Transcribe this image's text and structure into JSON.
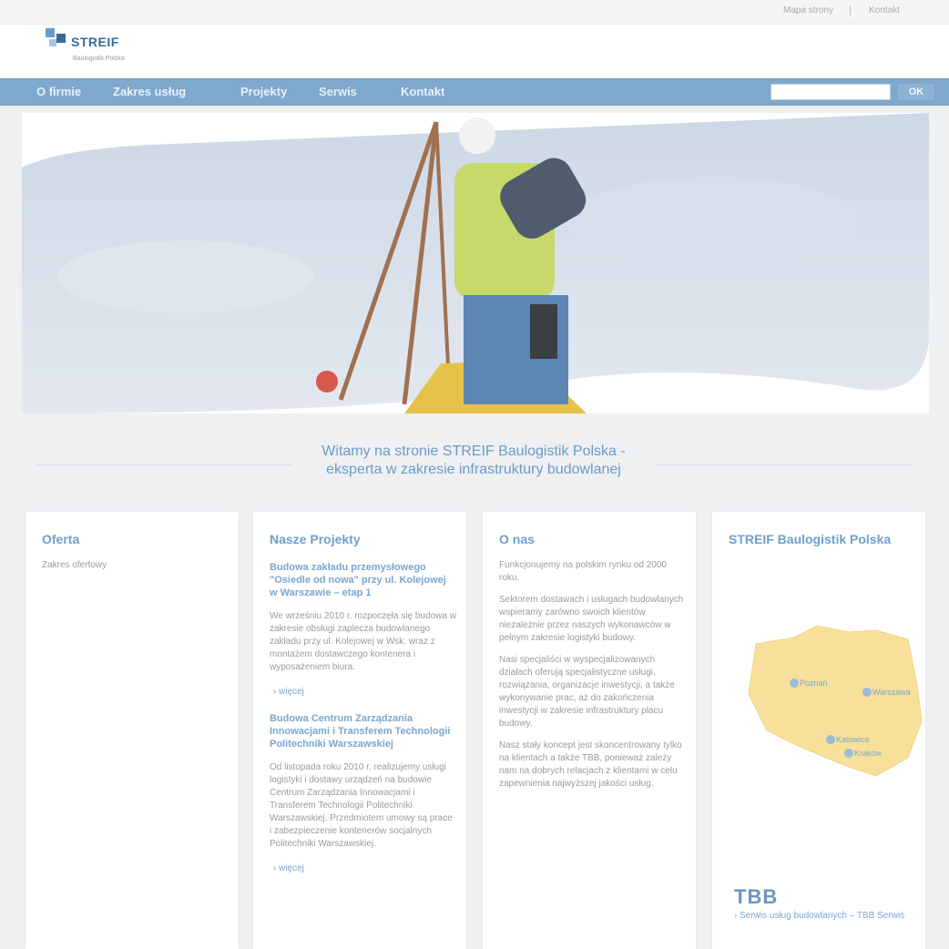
{
  "topbar": {
    "link1": "Mapa strony",
    "separator": "|",
    "link2": "Kontakt"
  },
  "logo": {
    "name": "STREIF",
    "tagline": "Baulogistik Polska"
  },
  "nav": {
    "items": [
      "O firmie",
      "Zakres usług",
      "Projekty",
      "Serwis",
      "Kontakt"
    ],
    "search_placeholder": "",
    "search_button": "OK"
  },
  "welcome": {
    "line1": "Witamy na stronie STREIF Baulogistik Polska -",
    "line2": "eksperta w zakresie infrastruktury budowlanej"
  },
  "cards": {
    "offer": {
      "title": "Oferta",
      "link": "Zakres ofertowy"
    },
    "projects": {
      "title": "Nasze Projekty",
      "p1_title": "Budowa zakładu przemysłowego \"Osiedle od nowa\" przy ul. Kolejowej w Warszawie – etap 1",
      "p1_text": "We wrześniu 2010 r. rozpoczęła się budowa w zakresie obsługi zaplecza budowlanego zakładu przy ul. Kolejowej w Wsk. wraz z montażem dostawczego kontenera i wyposażeniem biura.",
      "p1_more": "› więcej",
      "p2_title": "Budowa Centrum Zarządzania Innowacjami i Transferem Technologii Politechniki Warszawskiej",
      "p2_text": "Od listopada roku 2010 r. realizujemy usługi logistyki i dostawy urządzeń na budowie Centrum Zarządzania Innowacjami i Transferem Technologii Politechniki Warszawskiej. Przedmiotem umowy są prace i zabezpieczenie kontenerów socjalnych Politechniki Warszawskiej.",
      "p2_more": "› więcej"
    },
    "about": {
      "title": "O nas",
      "p1": "Funkcjonujemy na polskim rynku od 2000 roku.",
      "p2": "Sektorem dostawach i usługach budowlanych wspieramy zarówno swoich klientów niezależnie przez naszych wykonawców w pełnym zakresie logistyki budowy.",
      "p3": "Nasi specjaliści w wyspecjalizowanych działach oferują specjalistyczne usługi, rozwiązania, organizacje inwestycji, a także wykonywanie prac, aż do zakończenia inwestycji w zakresie infrastruktury placu budowy.",
      "p4": "Nasz stały koncept jest skoncentrowany tylko na klientach a także TBB, ponieważ zależy nam na dobrych relacjach z klientami w celu zapewnienia najwyższej jakości usług."
    },
    "company": {
      "title": "STREIF Baulogistik Polska",
      "cities": [
        "Poznań",
        "Warszawa",
        "Katowice",
        "Kraków"
      ],
      "tbb_logo": "TBB",
      "tbb_link": "› Serwis usług budowlanych – TBB Serwis"
    }
  },
  "colors": {
    "nav": "#7ea8cc",
    "accent": "#6f9fcb",
    "map": "#f7e19a"
  }
}
